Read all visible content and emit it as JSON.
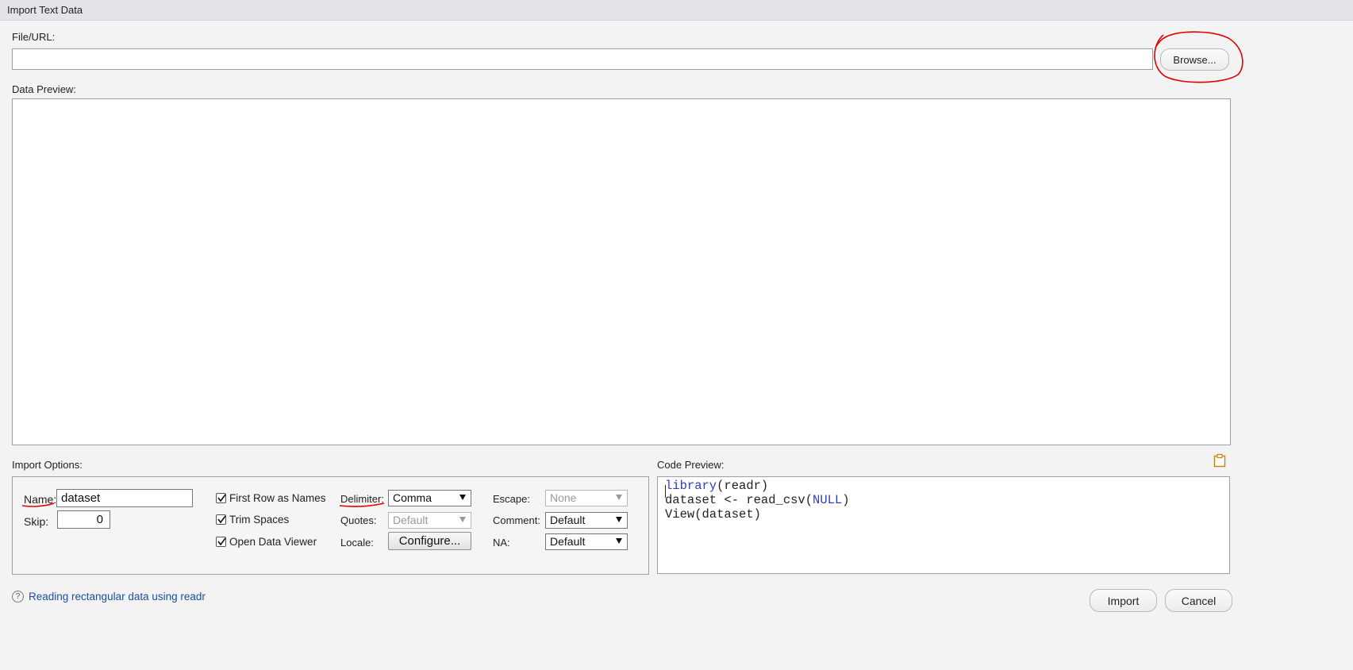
{
  "window": {
    "title": "Import Text Data"
  },
  "file": {
    "label": "File/URL:",
    "value": "",
    "browse_label": "Browse..."
  },
  "preview": {
    "label": "Data Preview:"
  },
  "options": {
    "label": "Import Options:",
    "name_label": "Name:",
    "name_value": "dataset",
    "skip_label": "Skip:",
    "skip_value": "0",
    "first_row": "First Row as Names",
    "trim": "Trim Spaces",
    "open_viewer": "Open Data Viewer",
    "delimiter_label": "Delimiter:",
    "delimiter_value": "Comma",
    "quotes_label": "Quotes:",
    "quotes_value": "Default",
    "locale_label": "Locale:",
    "configure_label": "Configure...",
    "escape_label": "Escape:",
    "escape_value": "None",
    "comment_label": "Comment:",
    "comment_value": "Default",
    "na_label": "NA:",
    "na_value": "Default"
  },
  "code": {
    "label": "Code Preview:",
    "l1_fn": "library",
    "l1_rest": "(readr)",
    "l2_a": "dataset <- read_csv(",
    "l2_kw": "NULL",
    "l2_b": ")",
    "l3": "View(dataset)"
  },
  "footer": {
    "help_link": "Reading rectangular data using readr",
    "import_label": "Import",
    "cancel_label": "Cancel"
  },
  "colors": {
    "annotation": "#e00000",
    "link": "#1a4fa0",
    "keyword": "#2c3ec2"
  }
}
